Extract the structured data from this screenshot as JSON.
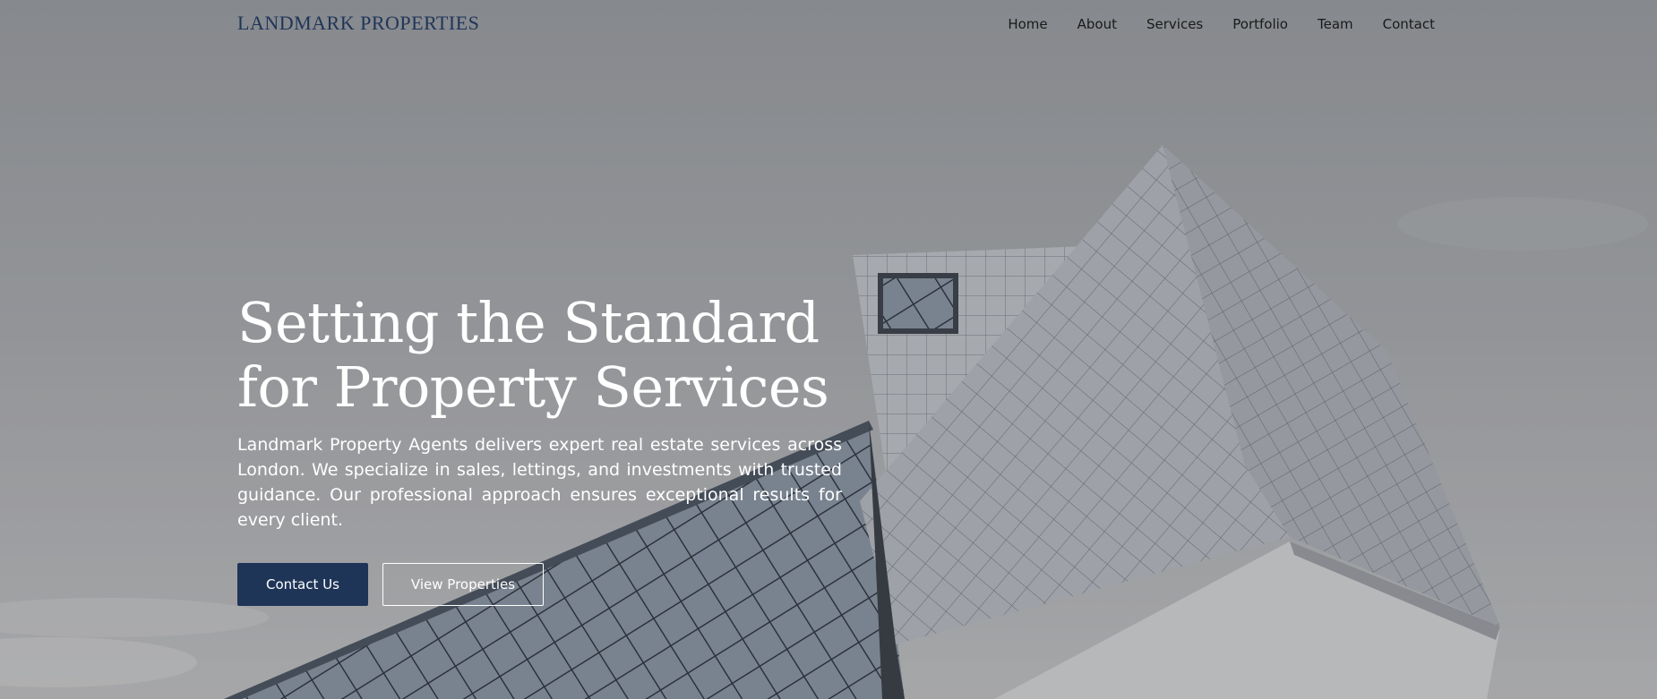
{
  "brand": {
    "name": "LANDMARK PROPERTIES",
    "color": "#1f3558"
  },
  "nav": {
    "items": [
      {
        "label": "Home"
      },
      {
        "label": "About"
      },
      {
        "label": "Services"
      },
      {
        "label": "Portfolio"
      },
      {
        "label": "Team"
      },
      {
        "label": "Contact"
      }
    ]
  },
  "hero": {
    "title_line1": "Setting the Standard",
    "title_line2": "for Property Services",
    "description": "Landmark Property Agents delivers expert real estate services across London. We specialize in sales, lettings, and investments with trusted guidance. Our professional approach ensures exceptional results for every client.",
    "background_image": "modern-glass-building"
  },
  "buttons": {
    "primary_label": "Contact Us",
    "secondary_label": "View Properties",
    "primary_color": "#1f3558"
  }
}
